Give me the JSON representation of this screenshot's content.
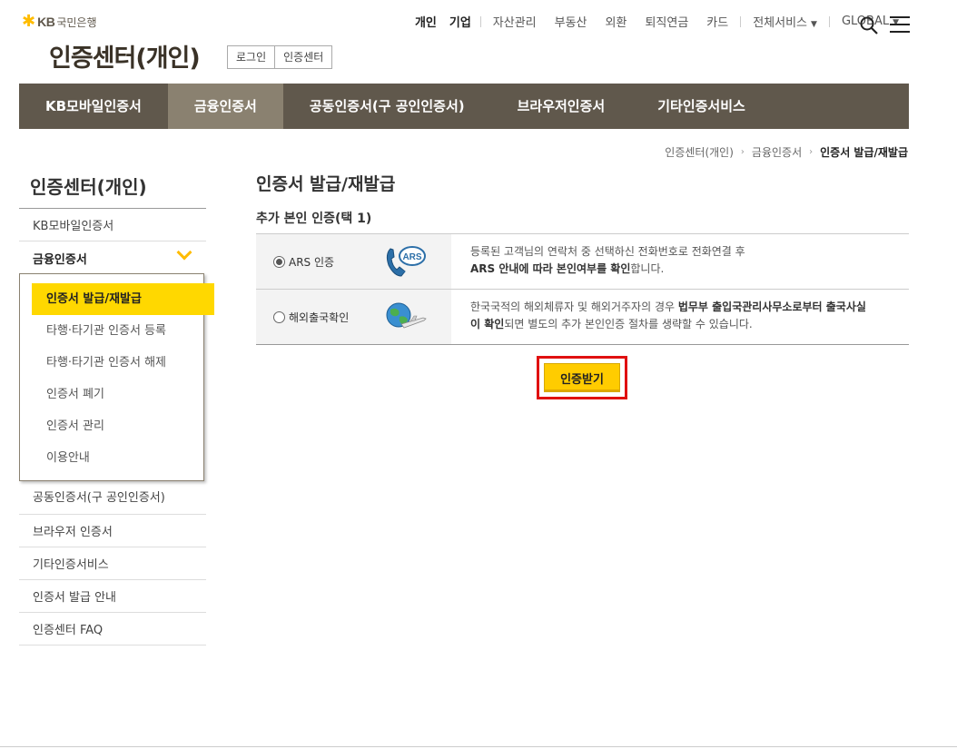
{
  "header": {
    "logo_kb": "KB",
    "logo_bank": "국민은행",
    "page_title": "인증센터(개인)",
    "sub_links": [
      "로그인",
      "인증센터"
    ]
  },
  "top_nav": {
    "items": [
      "개인",
      "기업",
      "자산관리",
      "부동산",
      "외환",
      "퇴직연금",
      "카드"
    ],
    "all_services": "전체서비스",
    "global": "GLOBAL"
  },
  "main_nav": {
    "tabs": [
      "KB모바일인증서",
      "금융인증서",
      "공동인증서(구 공인인증서)",
      "브라우저인증서",
      "기타인증서비스"
    ],
    "active_index": 1
  },
  "breadcrumb": [
    "인증센터(개인)",
    "금융인증서",
    "인증서 발급/재발급"
  ],
  "sidebar": {
    "title": "인증센터(개인)",
    "item_kb": "KB모바일인증서",
    "item_finance": "금융인증서",
    "submenu": [
      "인증서 발급/재발급",
      "타행·타기관 인증서 등록",
      "타행·타기관 인증서 해제",
      "인증서 폐기",
      "인증서 관리",
      "이용안내"
    ],
    "lower_items": [
      "공동인증서(구 공인인증서)",
      "브라우저 인증서",
      "기타인증서비스",
      "인증서 발급 안내",
      "인증센터 FAQ"
    ]
  },
  "content": {
    "title": "인증서 발급/재발급",
    "subtitle": "추가 본인 인증(택 1)",
    "options": [
      {
        "label": "ARS 인증",
        "checked": true,
        "icon": "ars-phone-icon",
        "desc_line1": "등록된 고객님의 연락처 중 선택하신 전화번호로 전화연결 후",
        "desc_line2_bold": "ARS 안내에 따라 본인여부를 확인",
        "desc_line2_rest": "합니다."
      },
      {
        "label": "해외출국확인",
        "checked": false,
        "icon": "globe-airplane-icon",
        "desc_line1_pre": "한국국적의 해외체류자 및 해외거주자의 경우 ",
        "desc_line1_bold": "법무부 출입국관리사무소로부터 출국사실",
        "desc_line2_bold": "이 확인",
        "desc_line2_rest": "되면 별도의 추가 본인인증 절차를 생략할 수 있습니다."
      }
    ],
    "submit_label": "인증받기"
  },
  "colors": {
    "brand_brown": "#60584c",
    "active_tab": "#8a8170",
    "accent_yellow": "#ffd800",
    "highlight_red": "#e01010"
  }
}
